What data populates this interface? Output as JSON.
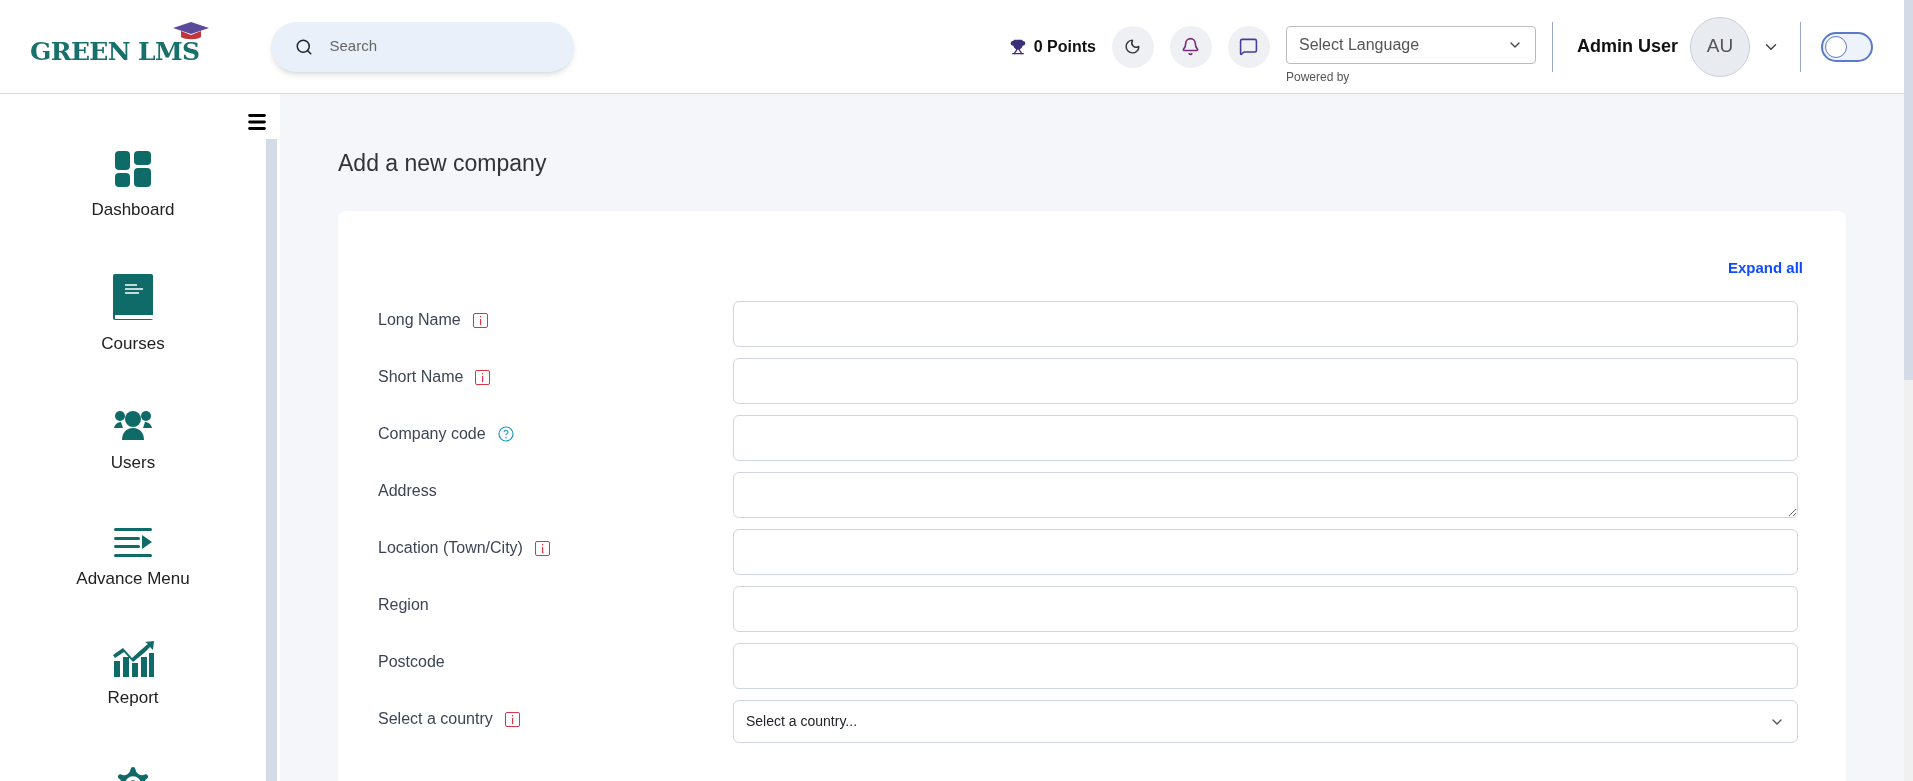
{
  "header": {
    "logo": "GREEN LMS",
    "search": {
      "placeholder": "Search"
    },
    "points": "0 Points",
    "language": {
      "value": "Select Language",
      "note": "Powered by"
    },
    "user": {
      "name": "Admin User",
      "initials": "AU"
    },
    "theme_toggle": {
      "on": false
    }
  },
  "sidebar": {
    "items": [
      {
        "kind": "dashboard",
        "label": "Dashboard"
      },
      {
        "kind": "courses",
        "label": "Courses"
      },
      {
        "kind": "users",
        "label": "Users"
      },
      {
        "kind": "menu",
        "label": "Advance Menu"
      },
      {
        "kind": "report",
        "label": "Report"
      },
      {
        "kind": "settings"
      }
    ]
  },
  "page": {
    "title": "Add a new company",
    "expand_link": "Expand all",
    "fields": [
      {
        "label": "Long Name",
        "hint": {
          "kind": "info"
        },
        "kind": "text"
      },
      {
        "label": "Short Name",
        "hint": {
          "kind": "info"
        },
        "kind": "text"
      },
      {
        "label": "Company code",
        "hint": {
          "kind": "help"
        },
        "kind": "text"
      },
      {
        "label": "Address",
        "kind": "textarea"
      },
      {
        "label": "Location (Town/City)",
        "hint": {
          "kind": "info"
        },
        "kind": "text"
      },
      {
        "label": "Region",
        "kind": "text"
      },
      {
        "label": "Postcode",
        "kind": "text"
      },
      {
        "label": "Select a country",
        "hint": {
          "kind": "info"
        },
        "kind": "select",
        "value": "Select a country..."
      }
    ]
  }
}
